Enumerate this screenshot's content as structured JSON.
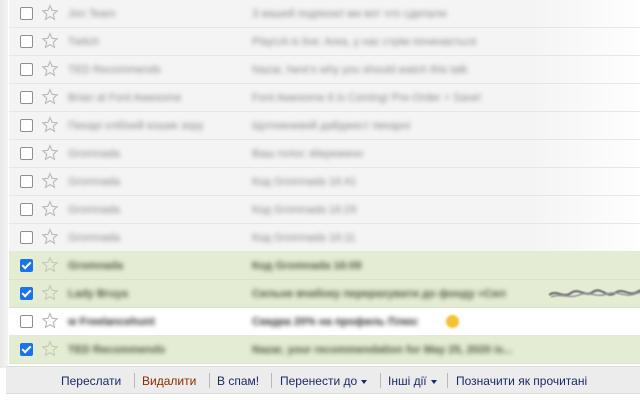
{
  "messages": [
    {
      "sender": "Jon Team",
      "subject": "З вашей подякою! ми вот что сделали",
      "checked": false,
      "read": true
    },
    {
      "sender": "Twitch",
      "subject": "PlayUA is live: Area, у нас стрім починається",
      "checked": false,
      "read": true
    },
    {
      "sender": "TED Recommends",
      "subject": "Nazar, here's why you should watch this talk",
      "checked": false,
      "read": true
    },
    {
      "sender": "Brian at Font Awesome",
      "subject": "Font Awesome 6 is Coming! Pre-Order + Save!",
      "checked": false,
      "read": true
    },
    {
      "sender": "Пекарі хлібний кошик зору",
      "subject": "Щотижневий дайджест пекарні",
      "checked": false,
      "read": true
    },
    {
      "sender": "Gromnada",
      "subject": "Ваш голос збережено",
      "checked": false,
      "read": true
    },
    {
      "sender": "Gromnada",
      "subject": "Код Gromnada 16:41",
      "checked": false,
      "read": true
    },
    {
      "sender": "Gromnada",
      "subject": "Код Gromnada 16:29",
      "checked": false,
      "read": true
    },
    {
      "sender": "Gromnada",
      "subject": "Код Gromnada 16:11",
      "checked": false,
      "read": true
    },
    {
      "sender": "Gromnada",
      "subject": "Код Gromnada 16:09",
      "checked": true,
      "read": false
    },
    {
      "sender": "Lady Bruya",
      "subject": "Сильне вчабоку перерахувати до фонду «Сил",
      "checked": true,
      "read": false
    },
    {
      "sender": "w Freelancehunt",
      "subject": "Скидка 20% на профиль Плюс",
      "checked": false,
      "read": false
    },
    {
      "sender": "TED Recommends",
      "subject": "Nazar, your recommendation for May 25, 2020 is...",
      "checked": true,
      "read": false
    }
  ],
  "toolbar": {
    "forward": "Переслати",
    "delete": "Видалити",
    "spam": "В спам!",
    "move_to": "Перенести до",
    "other_actions": "Інші дії",
    "mark_read": "Позначити як прочитані"
  },
  "colors": {
    "selected_row": "#e5ecd4",
    "read_row": "#f4f4f4",
    "checkbox_checked": "#1a73e8",
    "link": "#1b2a66",
    "delete_link": "#8a2a00"
  },
  "icons": {
    "star": "star-icon",
    "checkbox": "checkbox",
    "dropdown": "caret-down-icon"
  }
}
